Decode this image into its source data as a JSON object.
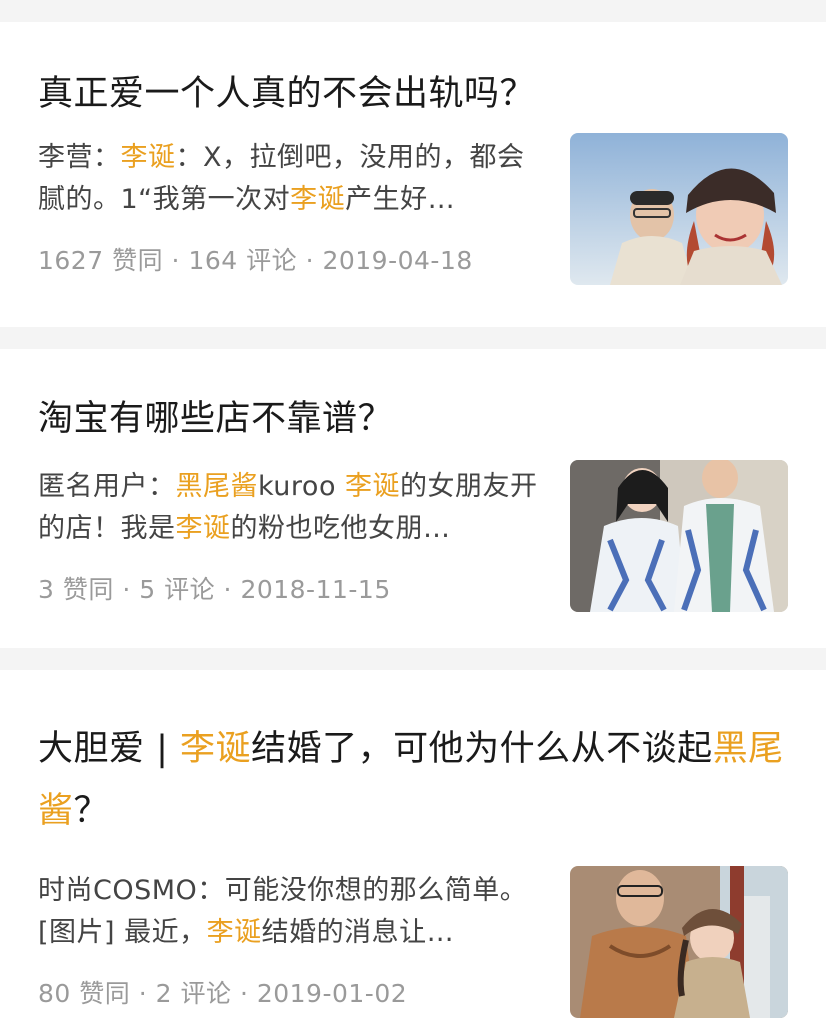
{
  "highlight_color": "#eaa020",
  "results": [
    {
      "title_parts": [
        "真正爱一个人真的不会出轨吗？"
      ],
      "author": "李营",
      "sep1": "：",
      "hl1": "李诞",
      "excerpt_a": "：X，拉倒吧，没用的，都会腻的。1“我第一次对",
      "hl2": "李诞",
      "excerpt_b": "产生好…",
      "likes": "1627 赞同",
      "comments": "164 评论",
      "date": "2019-04-18",
      "dot": "·",
      "image_label": "two-people-selfie"
    },
    {
      "title_parts": [
        "淘宝有哪些店不靠谱？"
      ],
      "author": "匿名用户",
      "sep1": "：",
      "hl1": "黑尾酱",
      "excerpt_a": "kuroo ",
      "hl2": "李诞",
      "excerpt_b": "的女朋友开的店！我是",
      "hl3": "李诞",
      "excerpt_c": "的粉也吃他女朋…",
      "likes": "3 赞同",
      "comments": "5 评论",
      "date": "2018-11-15",
      "dot": "·",
      "image_label": "couple-in-jackets"
    },
    {
      "title_a": "大胆爱 | ",
      "title_hl1": "李诞",
      "title_b": "结婚了，可他为什么从不谈起",
      "title_hl2": "黑尾酱",
      "title_c": "？",
      "author": "时尚COSMO",
      "sep1": "：",
      "excerpt_a": "可能没你想的那么简单。 [图片] 最近，",
      "hl1": "李诞",
      "excerpt_b": "结婚的消息让…",
      "likes": "80 赞同",
      "comments": "2 评论",
      "date": "2019-01-02",
      "dot": "·",
      "image_label": "couple-street-photo"
    }
  ]
}
